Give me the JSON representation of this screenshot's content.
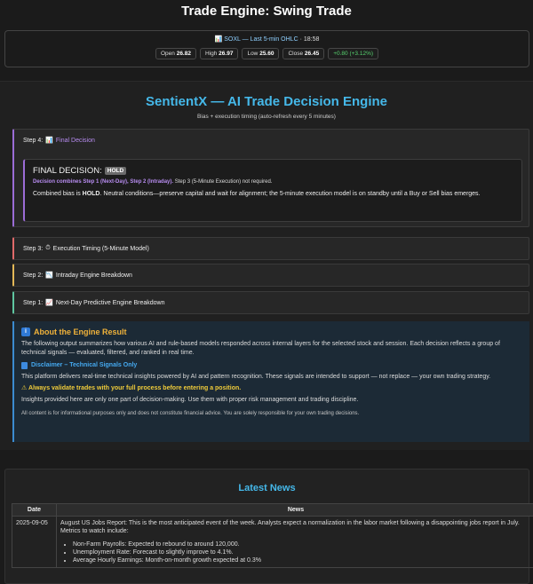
{
  "page_title": "Trade Engine: Swing Trade",
  "quote": {
    "symbol_line": "SOXL — Last 5-min OHLC",
    "separator": "·",
    "time": "18:58",
    "open_label": "Open",
    "open": "26.82",
    "high_label": "High",
    "high": "26.97",
    "low_label": "Low",
    "low": "25.60",
    "close_label": "Close",
    "close": "26.45",
    "change": "+0.80 (+3.12%)"
  },
  "engine": {
    "title": "SentientX — AI Trade Decision Engine",
    "subtitle": "Bias + execution timing (auto-refresh every 5 minutes)",
    "step4": {
      "label": "Step 4:",
      "title": "Final Decision",
      "decision_label": "FINAL DECISION:",
      "decision_badge": "HOLD",
      "combo_note_strong": "Decision combines Step 1 (Next-Day), Step 2 (Intraday).",
      "combo_note_rest": "Step 3 (5-Minute Execution) not required.",
      "body_prefix": "Combined bias is",
      "body_bold": "HOLD",
      "body_rest": ". Neutral conditions—preserve capital and wait for alignment; the 5-minute execution model is on standby until a Buy or Sell bias emerges."
    },
    "step3": {
      "label": "Step 3:",
      "title": "Execution Timing (5-Minute Model)"
    },
    "step2": {
      "label": "Step 2:",
      "title": "Intraday Engine Breakdown"
    },
    "step1": {
      "label": "Step 1:",
      "title": "Next-Day Predictive Engine Breakdown"
    }
  },
  "about": {
    "title": "About the Engine Result",
    "para1": "The following output summarizes how various AI and rule-based models responded across internal layers for the selected stock and session. Each decision reflects a group of technical signals — evaluated, filtered, and ranked in real time.",
    "disclaimer_title": "Disclaimer – Technical Signals Only",
    "para2": "This platform delivers real-time technical insights powered by AI and pattern recognition. These signals are intended to support — not replace — your own trading strategy.",
    "warning": "Always validate trades with your full process before entering a position.",
    "para3": "Insights provided here are only one part of decision-making. Use them with proper risk management and trading discipline.",
    "fine_print": "All content is for informational purposes only and does not constitute financial advice. You are solely responsible for your own trading decisions."
  },
  "news": {
    "title": "Latest News",
    "col_date": "Date",
    "col_news": "News",
    "rows": [
      {
        "date": "2025-09-05",
        "text": "August US Jobs Report: This is the most anticipated event of the week. Analysts expect a normalization in the labor market following a disappointing jobs report in July. Metrics to watch include:",
        "bullets": [
          "Non-Farm Payrolls: Expected to rebound to around 120,000.",
          "Unemployment Rate: Forecast to slightly improve to 4.1%.",
          "Average Hourly Earnings: Month-on-month growth expected at 0.3%"
        ]
      }
    ]
  },
  "colors": {
    "accent_blue": "#45b8e9",
    "step4": "#9b6cd6",
    "step3": "#e06a6a",
    "step2": "#e3b857",
    "step1": "#5fc6a0",
    "up": "#57d26f"
  },
  "icons": {
    "quote": "chart-icon",
    "step4": "chart-icon",
    "step3": "clock-icon",
    "step2": "chart-icon",
    "step1": "chart-icon",
    "about": "info-icon",
    "disclaimer": "document-icon",
    "warning": "warning-icon"
  }
}
